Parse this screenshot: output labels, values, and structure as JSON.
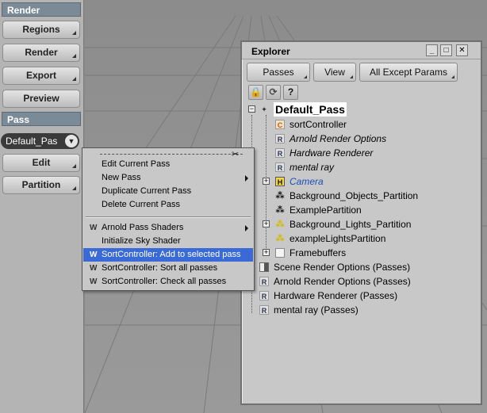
{
  "left_panel": {
    "render_header": "Render",
    "render_buttons": [
      "Regions",
      "Render",
      "Export",
      "Preview"
    ],
    "pass_header": "Pass",
    "current_pass": "Default_Pas",
    "pass_buttons": [
      "Edit",
      "Partition"
    ]
  },
  "explorer": {
    "title": "Explorer",
    "tabs": [
      "Passes",
      "View",
      "All Except Params"
    ],
    "tree": [
      {
        "label": "Default_Pass",
        "icon": "pass-icon",
        "depth": 0
      },
      {
        "label": "sortController",
        "icon": "C",
        "depth": 1
      },
      {
        "label": "Arnold Render Options",
        "icon": "R",
        "depth": 1
      },
      {
        "label": "Hardware Renderer",
        "icon": "R",
        "depth": 1
      },
      {
        "label": "mental ray",
        "icon": "R",
        "depth": 1
      },
      {
        "label": "Camera",
        "icon": "camera-icon",
        "depth": 1
      },
      {
        "label": "Background_Objects_Partition",
        "icon": "partition-icon",
        "depth": 1
      },
      {
        "label": "ExamplePartition",
        "icon": "partition-icon",
        "depth": 1
      },
      {
        "label": "Background_Lights_Partition",
        "icon": "light-partition-icon",
        "depth": 1
      },
      {
        "label": "exampleLightsPartition",
        "icon": "light-partition-icon",
        "depth": 1
      },
      {
        "label": "Framebuffers",
        "icon": "folder-icon",
        "depth": 1
      },
      {
        "label": "Scene Render Options (Passes)",
        "icon": "scene-options-icon",
        "depth": 0
      },
      {
        "label": "Arnold Render Options (Passes)",
        "icon": "render-options-icon",
        "depth": 0
      },
      {
        "label": "Hardware Renderer (Passes)",
        "icon": "render-options-icon",
        "depth": 0
      },
      {
        "label": "mental ray (Passes)",
        "icon": "render-options-icon",
        "depth": 0
      }
    ]
  },
  "context_menu": {
    "items": [
      {
        "label": "Edit Current Pass",
        "prefix": "",
        "submenu": false
      },
      {
        "label": "New Pass",
        "prefix": "",
        "submenu": true
      },
      {
        "label": "Duplicate Current Pass",
        "prefix": "",
        "submenu": false
      },
      {
        "label": "Delete Current Pass",
        "prefix": "",
        "submenu": false
      },
      {
        "label": "Arnold Pass Shaders",
        "prefix": "W",
        "submenu": true
      },
      {
        "label": "Initialize Sky Shader",
        "prefix": "",
        "submenu": false
      },
      {
        "label": "SortController: Add to selected pass",
        "prefix": "W",
        "submenu": false,
        "highlighted": true
      },
      {
        "label": "SortController: Sort all passes",
        "prefix": "W",
        "submenu": false
      },
      {
        "label": "SortController: Check all passes",
        "prefix": "W",
        "submenu": false
      }
    ]
  },
  "colors": {
    "highlight": "#3a6ad6",
    "panel": "#b4b4b4",
    "header": "#7a8a96"
  }
}
